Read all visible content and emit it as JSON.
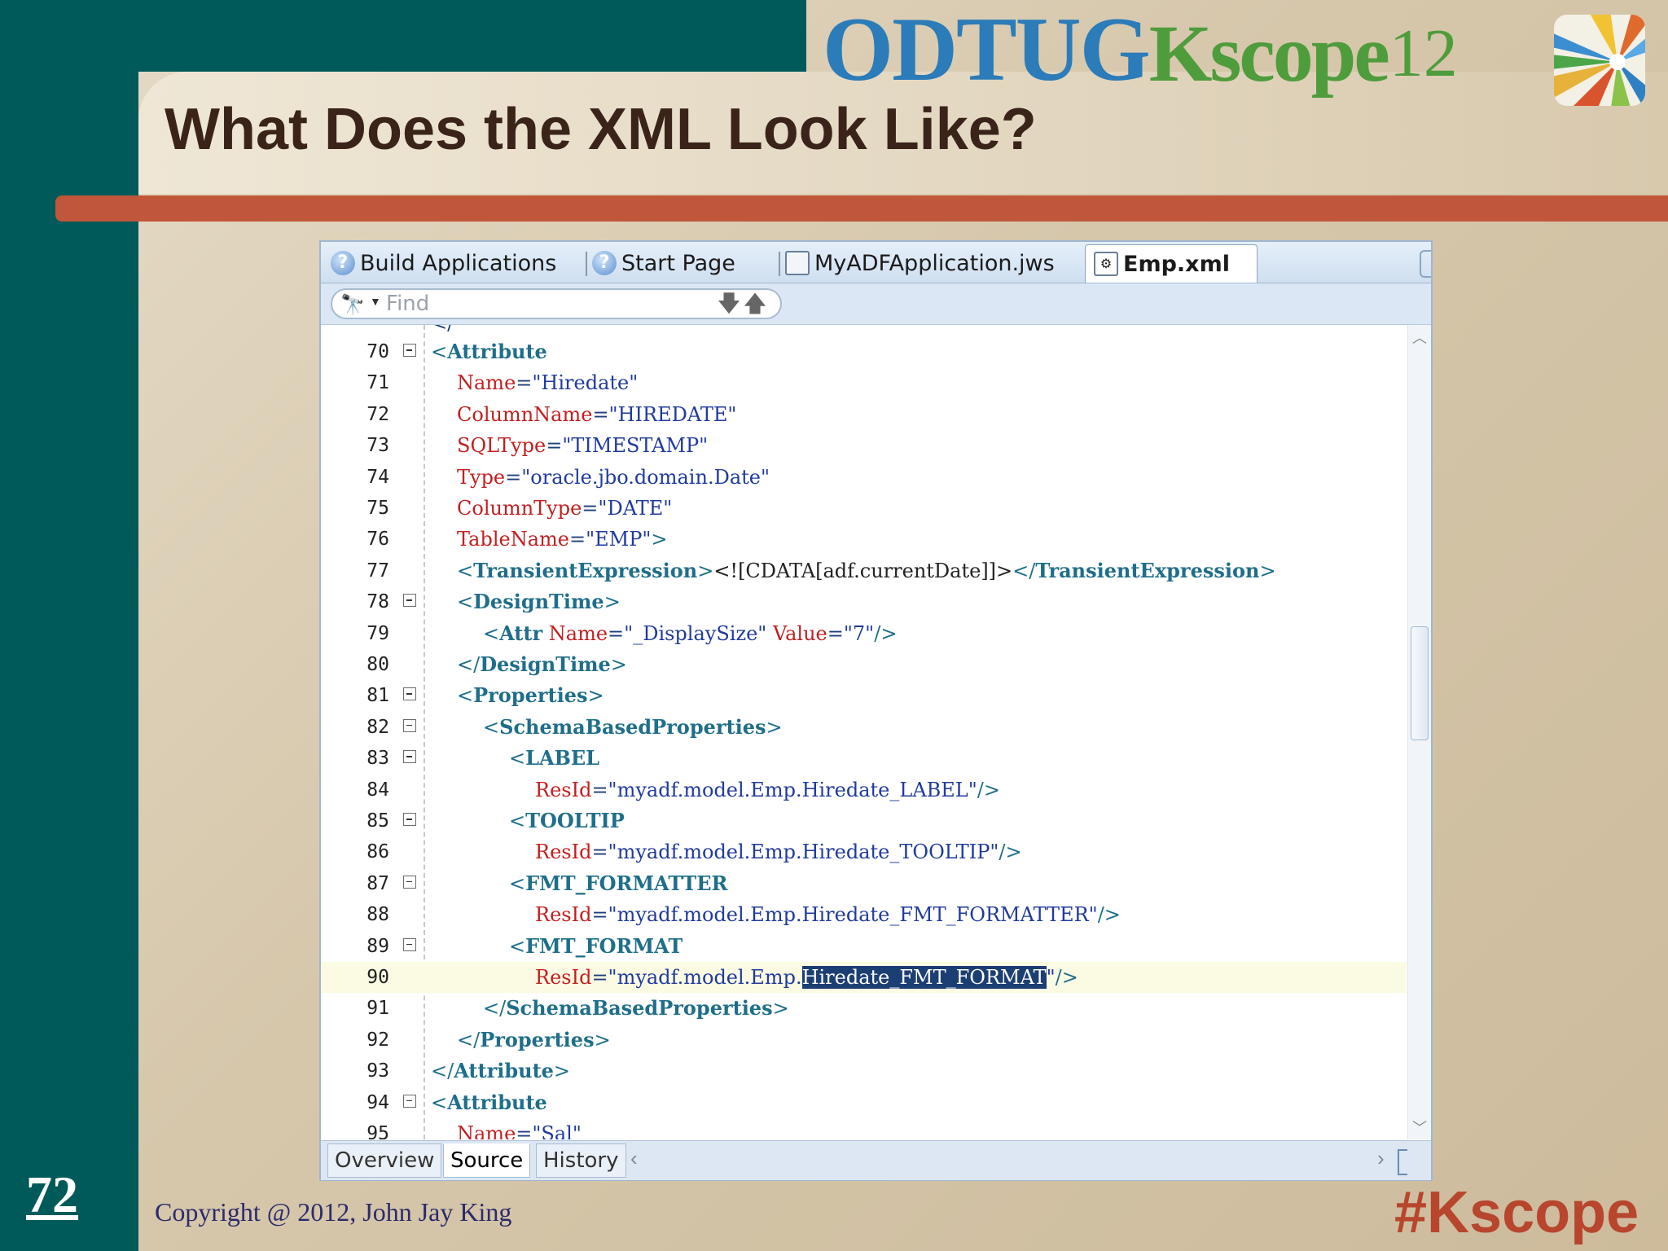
{
  "slide": {
    "title": "What Does the XML Look Like?",
    "page_number": "72",
    "copyright": "Copyright @ 2012, John Jay King",
    "hashtag": "#Kscope",
    "logo": {
      "part1": "ODTUG",
      "part2": "Kscope",
      "part3": "12"
    },
    "colors": {
      "band": "#005a5a",
      "rule": "#c0573a",
      "title": "#3a2419",
      "hashtag": "#b8452d"
    }
  },
  "ide": {
    "tabs": [
      {
        "label": "Build Applications",
        "icon": "help-icon",
        "active": false
      },
      {
        "label": "Start Page",
        "icon": "help-icon",
        "active": false
      },
      {
        "label": "MyADFApplication.jws",
        "icon": "workspace-icon",
        "active": false
      },
      {
        "label": "Emp.xml",
        "icon": "xml-file-icon",
        "active": true
      }
    ],
    "find": {
      "placeholder": "Find",
      "icon": "binoculars-icon"
    },
    "bottom_tabs": [
      {
        "label": "Overview",
        "active": false
      },
      {
        "label": "Source",
        "active": true
      },
      {
        "label": "History",
        "active": false
      }
    ],
    "current_line": "90",
    "selected_text": "Hiredate_FMT_FORMAT",
    "lines": [
      {
        "num": "70",
        "indent": 1,
        "fold": true,
        "tokens": [
          [
            "punct",
            "<"
          ],
          [
            "tag",
            "Attribute"
          ]
        ]
      },
      {
        "num": "71",
        "indent": 2,
        "fold": false,
        "tokens": [
          [
            "attr",
            "Name"
          ],
          [
            "eq",
            "="
          ],
          [
            "val",
            "\"Hiredate\""
          ]
        ]
      },
      {
        "num": "72",
        "indent": 2,
        "fold": false,
        "tokens": [
          [
            "attr",
            "ColumnName"
          ],
          [
            "eq",
            "="
          ],
          [
            "val",
            "\"HIREDATE\""
          ]
        ]
      },
      {
        "num": "73",
        "indent": 2,
        "fold": false,
        "tokens": [
          [
            "attr",
            "SQLType"
          ],
          [
            "eq",
            "="
          ],
          [
            "val",
            "\"TIMESTAMP\""
          ]
        ]
      },
      {
        "num": "74",
        "indent": 2,
        "fold": false,
        "tokens": [
          [
            "attr",
            "Type"
          ],
          [
            "eq",
            "="
          ],
          [
            "val",
            "\"oracle.jbo.domain.Date\""
          ]
        ]
      },
      {
        "num": "75",
        "indent": 2,
        "fold": false,
        "tokens": [
          [
            "attr",
            "ColumnType"
          ],
          [
            "eq",
            "="
          ],
          [
            "val",
            "\"DATE\""
          ]
        ]
      },
      {
        "num": "76",
        "indent": 2,
        "fold": false,
        "tokens": [
          [
            "attr",
            "TableName"
          ],
          [
            "eq",
            "="
          ],
          [
            "val",
            "\"EMP\""
          ],
          [
            "punct",
            ">"
          ]
        ]
      },
      {
        "num": "77",
        "indent": 2,
        "fold": false,
        "tokens": [
          [
            "punct",
            "<"
          ],
          [
            "tag",
            "TransientExpression"
          ],
          [
            "punct",
            ">"
          ],
          [
            "txt",
            "<![CDATA[adf.currentDate]]>"
          ],
          [
            "punct",
            "</"
          ],
          [
            "tag",
            "TransientExpression"
          ],
          [
            "punct",
            ">"
          ]
        ]
      },
      {
        "num": "78",
        "indent": 2,
        "fold": true,
        "tokens": [
          [
            "punct",
            "<"
          ],
          [
            "tag",
            "DesignTime"
          ],
          [
            "punct",
            ">"
          ]
        ]
      },
      {
        "num": "79",
        "indent": 3,
        "fold": false,
        "tokens": [
          [
            "punct",
            "<"
          ],
          [
            "tag",
            "Attr"
          ],
          [
            "txt",
            " "
          ],
          [
            "attr",
            "Name"
          ],
          [
            "eq",
            "="
          ],
          [
            "val",
            "\"_DisplaySize\""
          ],
          [
            "txt",
            " "
          ],
          [
            "attr",
            "Value"
          ],
          [
            "eq",
            "="
          ],
          [
            "val",
            "\"7\""
          ],
          [
            "punct",
            "/>"
          ]
        ]
      },
      {
        "num": "80",
        "indent": 2,
        "fold": false,
        "tokens": [
          [
            "punct",
            "</"
          ],
          [
            "tag",
            "DesignTime"
          ],
          [
            "punct",
            ">"
          ]
        ]
      },
      {
        "num": "81",
        "indent": 2,
        "fold": true,
        "tokens": [
          [
            "punct",
            "<"
          ],
          [
            "tag",
            "Properties"
          ],
          [
            "punct",
            ">"
          ]
        ]
      },
      {
        "num": "82",
        "indent": 3,
        "fold": true,
        "tokens": [
          [
            "punct",
            "<"
          ],
          [
            "tag",
            "SchemaBasedProperties"
          ],
          [
            "punct",
            ">"
          ]
        ]
      },
      {
        "num": "83",
        "indent": 4,
        "fold": true,
        "tokens": [
          [
            "punct",
            "<"
          ],
          [
            "tag",
            "LABEL"
          ]
        ]
      },
      {
        "num": "84",
        "indent": 5,
        "fold": false,
        "tokens": [
          [
            "attr",
            "ResId"
          ],
          [
            "eq",
            "="
          ],
          [
            "val",
            "\"myadf.model.Emp.Hiredate_LABEL\""
          ],
          [
            "punct",
            "/>"
          ]
        ]
      },
      {
        "num": "85",
        "indent": 4,
        "fold": true,
        "tokens": [
          [
            "punct",
            "<"
          ],
          [
            "tag",
            "TOOLTIP"
          ]
        ]
      },
      {
        "num": "86",
        "indent": 5,
        "fold": false,
        "tokens": [
          [
            "attr",
            "ResId"
          ],
          [
            "eq",
            "="
          ],
          [
            "val",
            "\"myadf.model.Emp.Hiredate_TOOLTIP\""
          ],
          [
            "punct",
            "/>"
          ]
        ]
      },
      {
        "num": "87",
        "indent": 4,
        "fold": true,
        "tokens": [
          [
            "punct",
            "<"
          ],
          [
            "tag",
            "FMT_FORMATTER"
          ]
        ]
      },
      {
        "num": "88",
        "indent": 5,
        "fold": false,
        "tokens": [
          [
            "attr",
            "ResId"
          ],
          [
            "eq",
            "="
          ],
          [
            "val",
            "\"myadf.model.Emp.Hiredate_FMT_FORMATTER\""
          ],
          [
            "punct",
            "/>"
          ]
        ]
      },
      {
        "num": "89",
        "indent": 4,
        "fold": true,
        "tokens": [
          [
            "punct",
            "<"
          ],
          [
            "tag",
            "FMT_FORMAT"
          ]
        ]
      },
      {
        "num": "90",
        "indent": 5,
        "fold": false,
        "tokens": [
          [
            "attr",
            "ResId"
          ],
          [
            "eq",
            "="
          ],
          [
            "val",
            "\"myadf.model.Emp."
          ],
          [
            "sel",
            "Hiredate_FMT_FORMAT"
          ],
          [
            "val",
            "\""
          ],
          [
            "punct",
            "/>"
          ]
        ]
      },
      {
        "num": "91",
        "indent": 3,
        "fold": false,
        "tokens": [
          [
            "punct",
            "</"
          ],
          [
            "tag",
            "SchemaBasedProperties"
          ],
          [
            "punct",
            ">"
          ]
        ]
      },
      {
        "num": "92",
        "indent": 2,
        "fold": false,
        "tokens": [
          [
            "punct",
            "</"
          ],
          [
            "tag",
            "Properties"
          ],
          [
            "punct",
            ">"
          ]
        ]
      },
      {
        "num": "93",
        "indent": 1,
        "fold": false,
        "tokens": [
          [
            "punct",
            "</"
          ],
          [
            "tag",
            "Attribute"
          ],
          [
            "punct",
            ">"
          ]
        ]
      },
      {
        "num": "94",
        "indent": 1,
        "fold": true,
        "tokens": [
          [
            "punct",
            "<"
          ],
          [
            "tag",
            "Attribute"
          ]
        ]
      },
      {
        "num": "95",
        "indent": 2,
        "fold": false,
        "tokens": [
          [
            "attr",
            "Name"
          ],
          [
            "eq",
            "="
          ],
          [
            "val",
            "\"Sal\""
          ]
        ]
      }
    ]
  }
}
